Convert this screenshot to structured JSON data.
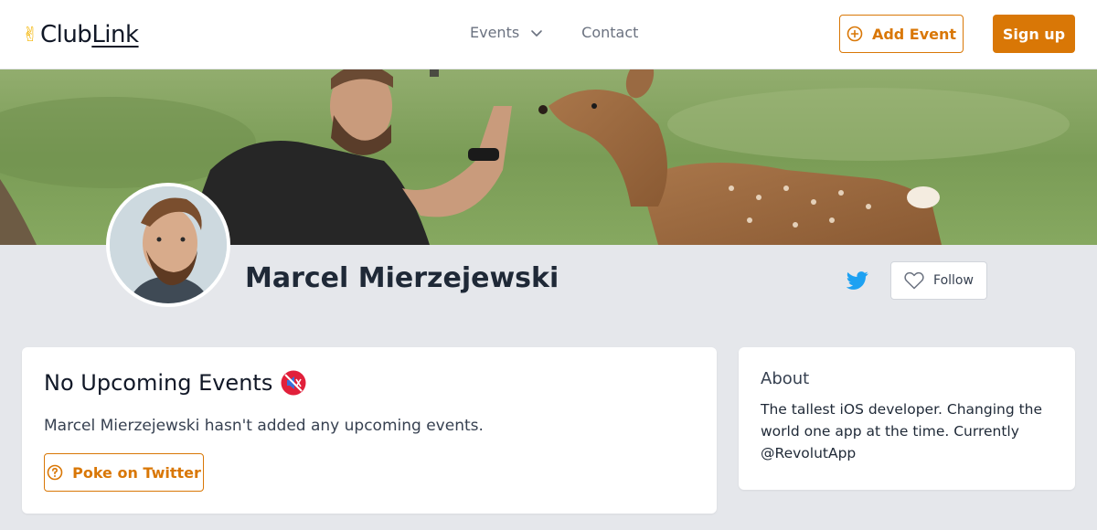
{
  "brand": {
    "logo_text_a": "Club",
    "logo_text_b": "Link",
    "accent": "#d97706"
  },
  "nav": {
    "events_label": "Events",
    "contact_label": "Contact"
  },
  "header": {
    "add_event_label": "Add Event",
    "signup_label": "Sign up"
  },
  "profile": {
    "name": "Marcel Mierzejewski",
    "follow_label": "Follow"
  },
  "events_card": {
    "title": "No Upcoming Events",
    "description": "Marcel Mierzejewski hasn't added any upcoming events.",
    "poke_label": "Poke on Twitter"
  },
  "about_card": {
    "title": "About",
    "body": "The tallest iOS developer. Changing the world one app at the time. Currently @RevolutApp"
  },
  "icons": {
    "logo": "victory-hand-icon",
    "events_dropdown": "chevron-down-icon",
    "add_event": "plus-circle-icon",
    "twitter": "twitter-icon",
    "follow": "heart-icon",
    "title_emoji": "muted-speaker-icon",
    "poke": "question-circle-icon"
  }
}
